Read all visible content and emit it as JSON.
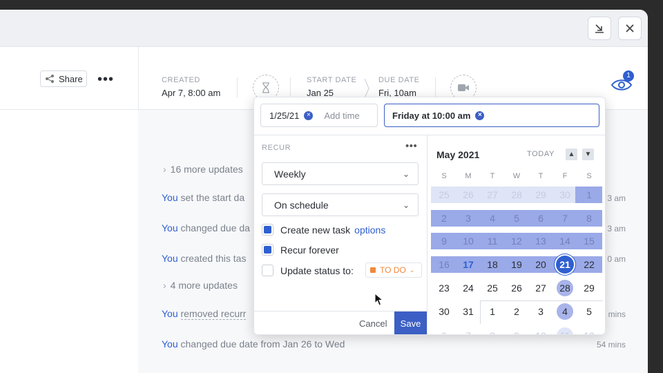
{
  "header": {
    "share_label": "Share",
    "created_label": "CREATED",
    "created_value": "Apr 7, 8:00 am",
    "start_label": "START DATE",
    "start_value": "Jan 25",
    "due_label": "DUE DATE",
    "due_value": "Fri, 10am",
    "watchers_count": "1"
  },
  "activity": {
    "more1": "16 more updates",
    "row1_you": "You",
    "row1_text": "set the start da",
    "row1_time": "3 am",
    "row2_you": "You",
    "row2_text": "changed due da",
    "row2_time": "3 am",
    "row3_you": "You",
    "row3_text": "created this tas",
    "row3_time": "0 am",
    "more2": "4 more updates",
    "row4_you": "You",
    "row4_text": "removed recurr",
    "row4_time": "mins",
    "row5_you": "You",
    "row5_text": "changed due date from Jan 26 to Wed",
    "row5_time": "54 mins"
  },
  "popup": {
    "start_date_value": "1/25/21",
    "add_time_placeholder": "Add time",
    "due_date_value": "Friday at 10:00 am",
    "recur_label": "RECUR",
    "frequency_value": "Weekly",
    "schedule_value": "On schedule",
    "create_task_label": "Create new task",
    "options_link": "options",
    "recur_forever_label": "Recur forever",
    "update_status_label": "Update status to:",
    "status_value": "TO DO",
    "cancel_label": "Cancel",
    "save_label": "Save"
  },
  "calendar": {
    "month_label": "May 2021",
    "today_label": "TODAY",
    "weekdays": [
      "S",
      "M",
      "T",
      "W",
      "T",
      "F",
      "S"
    ],
    "weeks": [
      [
        "25",
        "26",
        "27",
        "28",
        "29",
        "30",
        "1"
      ],
      [
        "2",
        "3",
        "4",
        "5",
        "6",
        "7",
        "8"
      ],
      [
        "9",
        "10",
        "11",
        "12",
        "13",
        "14",
        "15"
      ],
      [
        "16",
        "17",
        "18",
        "19",
        "20",
        "21",
        "22"
      ],
      [
        "23",
        "24",
        "25",
        "26",
        "27",
        "28",
        "29"
      ],
      [
        "30",
        "31",
        "1",
        "2",
        "3",
        "4",
        "5"
      ],
      [
        "6",
        "7",
        "8",
        "9",
        "10",
        "11",
        "12"
      ]
    ],
    "selected_day": "21",
    "today_day": "17"
  },
  "colors": {
    "accent": "#2f5fd0",
    "range_band": "#9aa9e8",
    "status_orange": "#f0883e"
  }
}
